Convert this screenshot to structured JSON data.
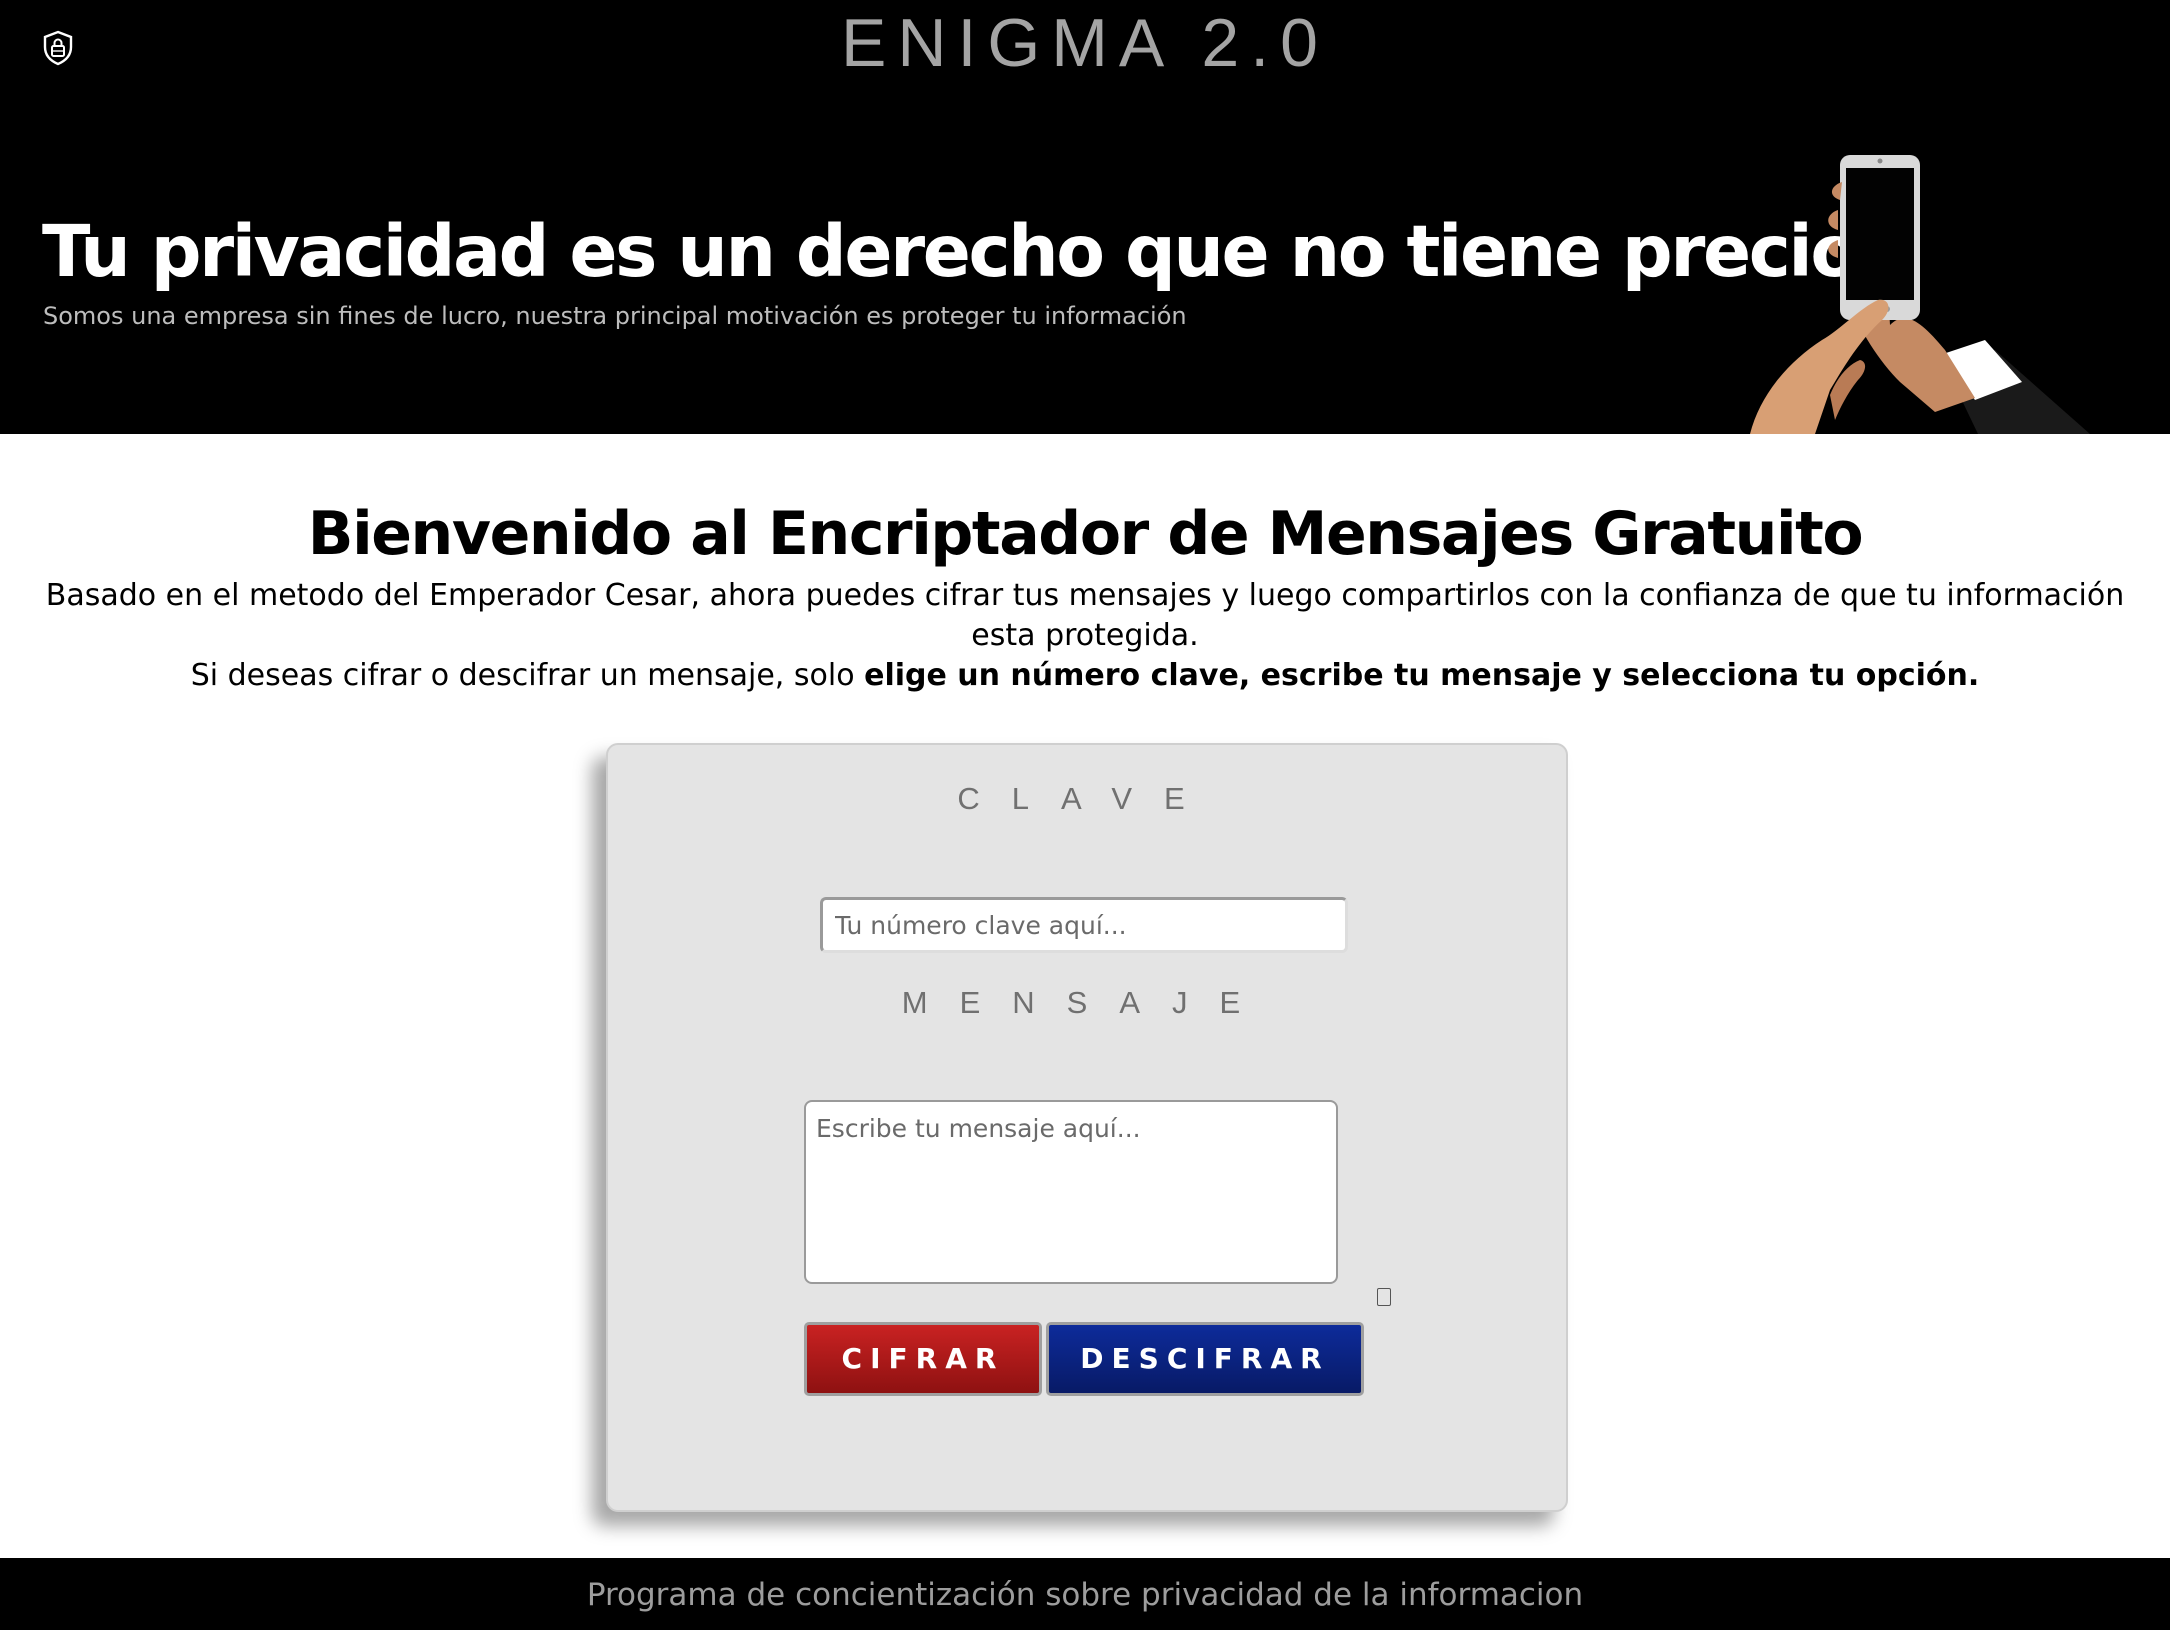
{
  "header": {
    "brand": "ENIGMA 2.0",
    "title": "Tu privacidad es un derecho que no tiene precio",
    "subtitle": "Somos una empresa sin fines de lucro, nuestra principal motivación es proteger tu información"
  },
  "intro": {
    "heading": "Bienvenido al Encriptador de Mensajes Gratuito",
    "paragraph1": "Basado en el metodo del Emperador Cesar, ahora puedes cifrar tus mensajes y luego compartirlos con la confianza de que tu información esta protegida.",
    "paragraph2_prefix": "Si deseas cifrar o descifrar un mensaje, solo ",
    "paragraph2_bold": "elige un número clave, escribe tu mensaje y selecciona tu opción."
  },
  "form": {
    "key_label": "CLAVE",
    "key_placeholder": "Tu número clave aquí...",
    "key_value": "",
    "message_label": "MENSAJE",
    "message_placeholder": "Escribe tu mensaje aquí...",
    "message_value": "",
    "encrypt_button": "CIFRAR",
    "decrypt_button": "DESCIFRAR"
  },
  "footer": {
    "text": "Programa de concientización sobre privacidad de la informacion"
  },
  "colors": {
    "encrypt": "#b01a1a",
    "decrypt": "#0b2280",
    "header_bg": "#000000",
    "card_bg": "#e4e4e4"
  },
  "icons": {
    "logo": "shield-lock-icon",
    "hero_image": "hands-holding-phone-illustration"
  }
}
